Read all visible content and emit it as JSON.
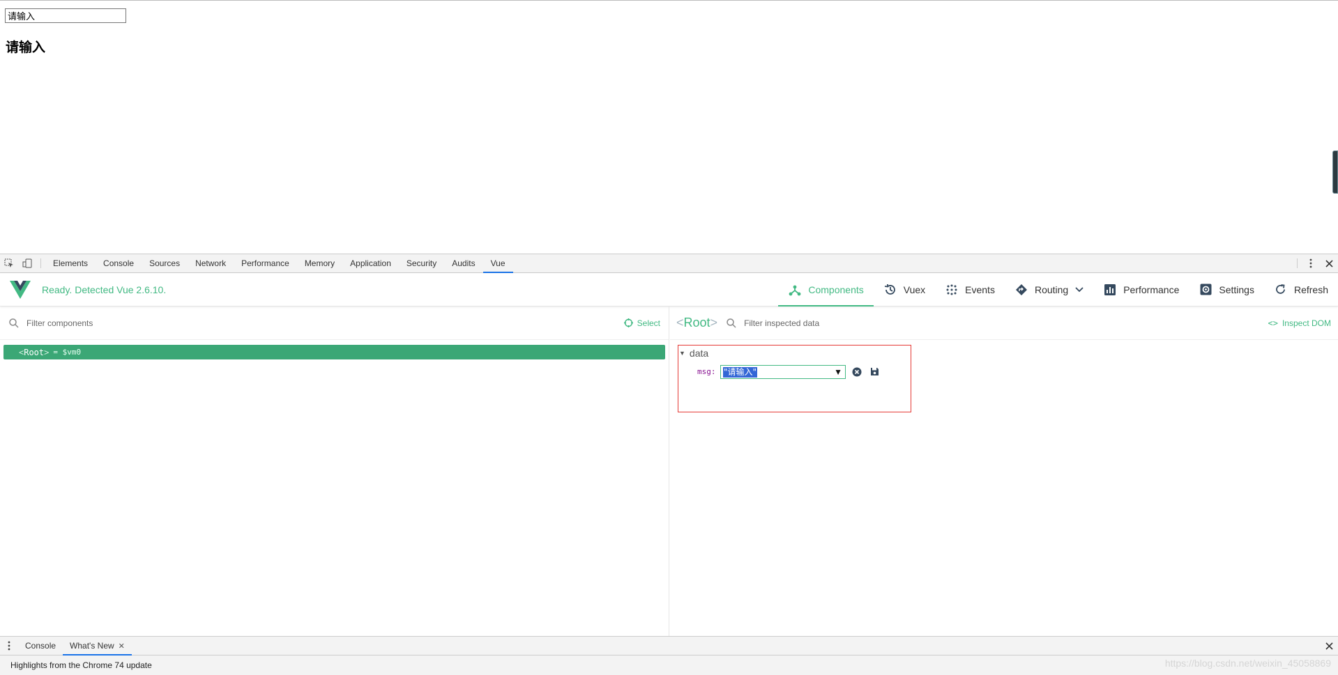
{
  "page": {
    "input_value": "请输入",
    "heading": "请输入"
  },
  "devtools": {
    "tabs": [
      "Elements",
      "Console",
      "Sources",
      "Network",
      "Performance",
      "Memory",
      "Application",
      "Security",
      "Audits",
      "Vue"
    ],
    "active_tab": "Vue"
  },
  "vue": {
    "status": "Ready. Detected Vue 2.6.10.",
    "nav": {
      "components": "Components",
      "vuex": "Vuex",
      "events": "Events",
      "routing": "Routing",
      "performance": "Performance",
      "settings": "Settings",
      "refresh": "Refresh"
    },
    "brand_color": "#42b983",
    "left": {
      "filter_placeholder": "Filter components",
      "select_label": "Select",
      "tree": {
        "open": "<",
        "name": "Root",
        "close": ">",
        "vm": "= $vm0"
      }
    },
    "right": {
      "root_open": "<",
      "root_name": "Root",
      "root_close": ">",
      "filter_placeholder": "Filter inspected data",
      "inspect_code": "<>",
      "inspect_label": "Inspect DOM",
      "section": "data",
      "key": "msg:",
      "value": "\"请输入\""
    }
  },
  "drawer": {
    "console_tab": "Console",
    "whats_new_tab": "What's New",
    "content": "Highlights from the Chrome 74 update"
  },
  "watermark": "https://blog.csdn.net/weixin_45058869"
}
